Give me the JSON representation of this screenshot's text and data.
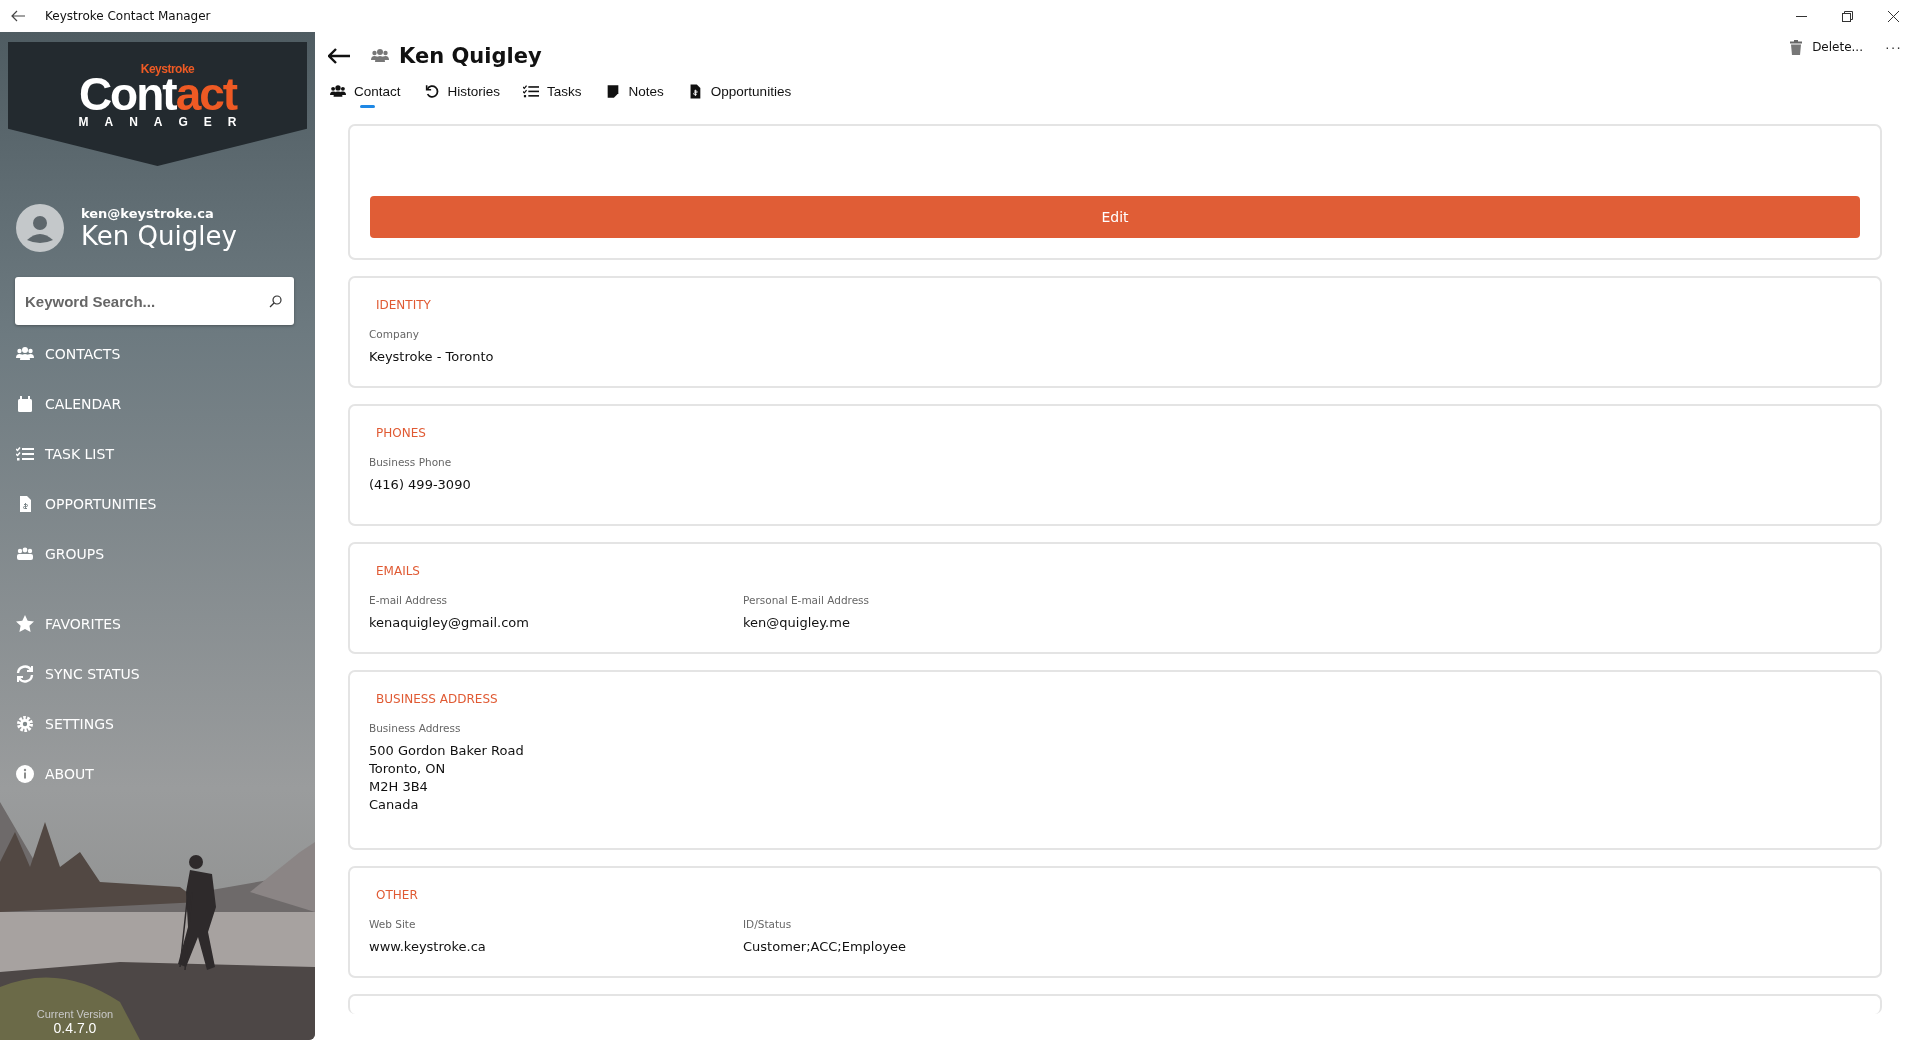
{
  "window": {
    "title": "Keystroke Contact Manager"
  },
  "logo": {
    "brand": "Keystroke",
    "word_a": "Cont",
    "word_b": "act",
    "sub": "MANAGER"
  },
  "user": {
    "email": "ken@keystroke.ca",
    "name": "Ken Quigley"
  },
  "search": {
    "placeholder": "Keyword Search..."
  },
  "nav_primary": [
    {
      "label": "CONTACTS"
    },
    {
      "label": "CALENDAR"
    },
    {
      "label": "TASK LIST"
    },
    {
      "label": "OPPORTUNITIES"
    },
    {
      "label": "GROUPS"
    }
  ],
  "nav_secondary": [
    {
      "label": "FAVORITES"
    },
    {
      "label": "SYNC STATUS"
    },
    {
      "label": "SETTINGS"
    },
    {
      "label": "ABOUT"
    }
  ],
  "version": {
    "label": "Current Version",
    "value": "0.4.7.0"
  },
  "header": {
    "title": "Ken Quigley",
    "delete": "Delete...",
    "more": "···"
  },
  "tabs": [
    {
      "label": "Contact",
      "selected": true
    },
    {
      "label": "Histories",
      "selected": false
    },
    {
      "label": "Tasks",
      "selected": false
    },
    {
      "label": "Notes",
      "selected": false
    },
    {
      "label": "Opportunities",
      "selected": false
    }
  ],
  "edit_button": "Edit",
  "sections": [
    {
      "title": "IDENTITY",
      "fields": [
        {
          "label": "Company",
          "lines": [
            "Keystroke - Toronto"
          ]
        }
      ]
    },
    {
      "title": "PHONES",
      "fields": [
        {
          "label": "Business Phone",
          "lines": [
            "(416) 499-3090"
          ]
        }
      ]
    },
    {
      "title": "EMAILS",
      "fields": [
        {
          "label": "E-mail Address",
          "lines": [
            "kenaquigley@gmail.com"
          ]
        },
        {
          "label": "Personal E-mail Address",
          "lines": [
            "ken@quigley.me"
          ]
        }
      ]
    },
    {
      "title": "BUSINESS ADDRESS",
      "fields": [
        {
          "label": "Business Address",
          "lines": [
            "500 Gordon Baker Road",
            "Toronto, ON",
            "M2H 3B4",
            "Canada"
          ]
        }
      ]
    },
    {
      "title": "OTHER",
      "fields": [
        {
          "label": "Web Site",
          "lines": [
            "www.keystroke.ca"
          ]
        },
        {
          "label": "ID/Status",
          "lines": [
            "Customer;ACC;Employee"
          ]
        }
      ]
    }
  ]
}
